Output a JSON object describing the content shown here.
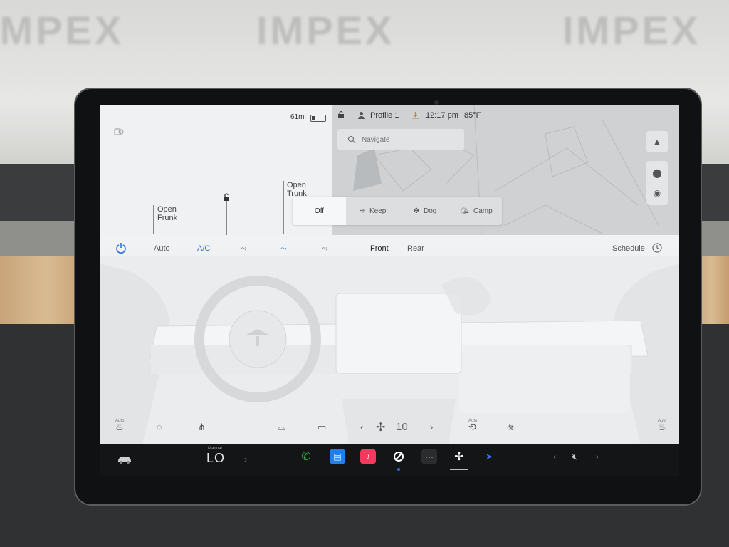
{
  "watermark": "IMPEX",
  "car": {
    "range": "61mi",
    "frunk_left_line1": "Open",
    "frunk_left_line2": "Frunk",
    "frunk_right_line1": "Open",
    "frunk_right_line2": "Trunk"
  },
  "status": {
    "profile": "Profile 1",
    "time": "12:17 pm",
    "temp_outside": "85°F"
  },
  "map": {
    "nav_placeholder": "Navigate"
  },
  "modes": [
    {
      "label": "Off",
      "selected": true
    },
    {
      "label": "Keep",
      "selected": false
    },
    {
      "label": "Dog",
      "selected": false
    },
    {
      "label": "Camp",
      "selected": false
    }
  ],
  "climate": {
    "auto": "Auto",
    "ac": "A/C",
    "front": "Front",
    "rear": "Rear",
    "schedule": "Schedule",
    "fan_speed": "10",
    "auto_small": "Auto"
  },
  "taskbar": {
    "temp_mode": "Manual",
    "temp": "LO",
    "dots": "···"
  },
  "colors": {
    "accent": "#2f6fd6",
    "phone": "#2fb24a",
    "messages": "#1d7ff0",
    "music": "#f23b5c",
    "bezel": "#101113"
  }
}
